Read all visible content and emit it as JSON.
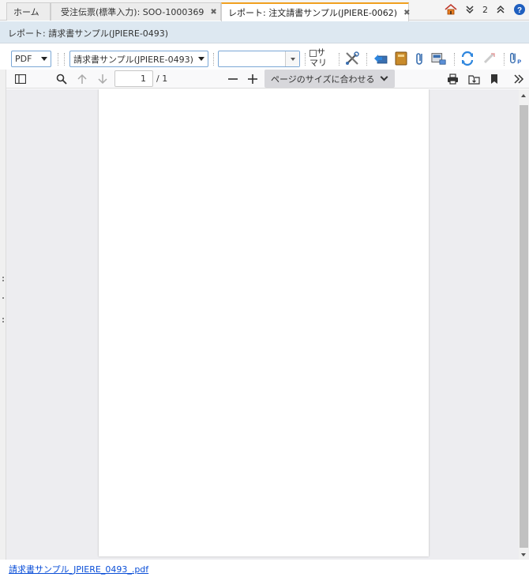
{
  "tabs": {
    "home_label": "ホーム",
    "tab2_label": "受注伝票(標準入力): SOO-1000369",
    "tab3_label": "レポート: 注文請書サンプル(JPIERE-0062)",
    "overflow_count": "2"
  },
  "window": {
    "title": "レポート: 請求書サンプル(JPIERE-0493)"
  },
  "toolbar": {
    "format_value": "PDF",
    "report_value": "請求書サンプル(JPIERE-0493)",
    "combo_value": "",
    "summary_label_line1": "サ",
    "summary_label_line2": "マリ"
  },
  "pdf_viewer": {
    "page_number": "1",
    "page_total": "/ 1",
    "zoom_label": "ページのサイズに合わせる"
  },
  "footer": {
    "file_link": "請求書サンプル_JPIERE_0493_.pdf"
  },
  "colors": {
    "active_tab_accent": "#f0a020",
    "title_bar_bg": "#dde8f1",
    "link_color": "#0b4fd8"
  }
}
